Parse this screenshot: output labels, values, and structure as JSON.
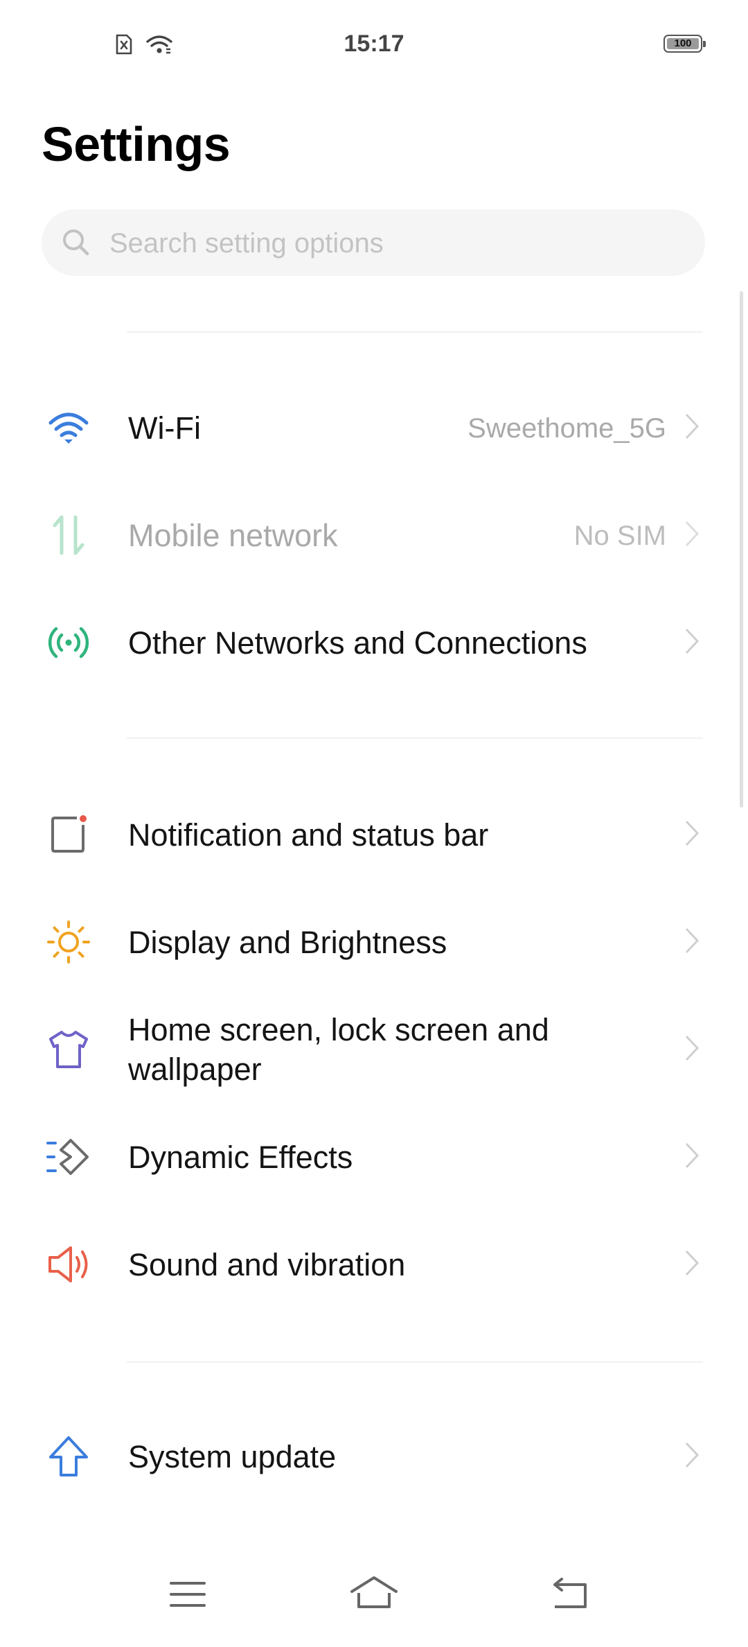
{
  "status_bar": {
    "time": "15:17",
    "battery": "100",
    "icons": [
      "no-sim-icon",
      "wifi-icon"
    ]
  },
  "header": {
    "title": "Settings"
  },
  "search": {
    "placeholder": "Search setting options"
  },
  "items": [
    {
      "label": "Wi-Fi",
      "value": "Sweethome_5G",
      "icon": "wifi-icon",
      "color": "#3b7ddd"
    },
    {
      "label": "Mobile network",
      "value": "No SIM",
      "icon": "mobile-data-icon",
      "color": "#b8e3cc",
      "disabled": true
    },
    {
      "label": "Other Networks and Connections",
      "value": "",
      "icon": "connections-icon",
      "color": "#2fb47c"
    },
    {
      "label": "Notification and status bar",
      "value": "",
      "icon": "notification-icon",
      "color": "#6b6b6b",
      "accent": "#e8584a"
    },
    {
      "label": "Display and Brightness",
      "value": "",
      "icon": "brightness-icon",
      "color": "#f0a321"
    },
    {
      "label": "Home screen, lock screen and wallpaper",
      "value": "",
      "icon": "theme-shirt-icon",
      "color": "#6f62c8"
    },
    {
      "label": "Dynamic Effects",
      "value": "",
      "icon": "dynamic-effects-icon",
      "color": "#3b7ddd"
    },
    {
      "label": "Sound and vibration",
      "value": "",
      "icon": "speaker-icon",
      "color": "#e8604a"
    },
    {
      "label": "System update",
      "value": "",
      "icon": "update-arrow-icon",
      "color": "#3b7ddd"
    }
  ],
  "nav_bar": {
    "buttons": [
      "menu-icon",
      "home-icon",
      "back-icon"
    ]
  }
}
